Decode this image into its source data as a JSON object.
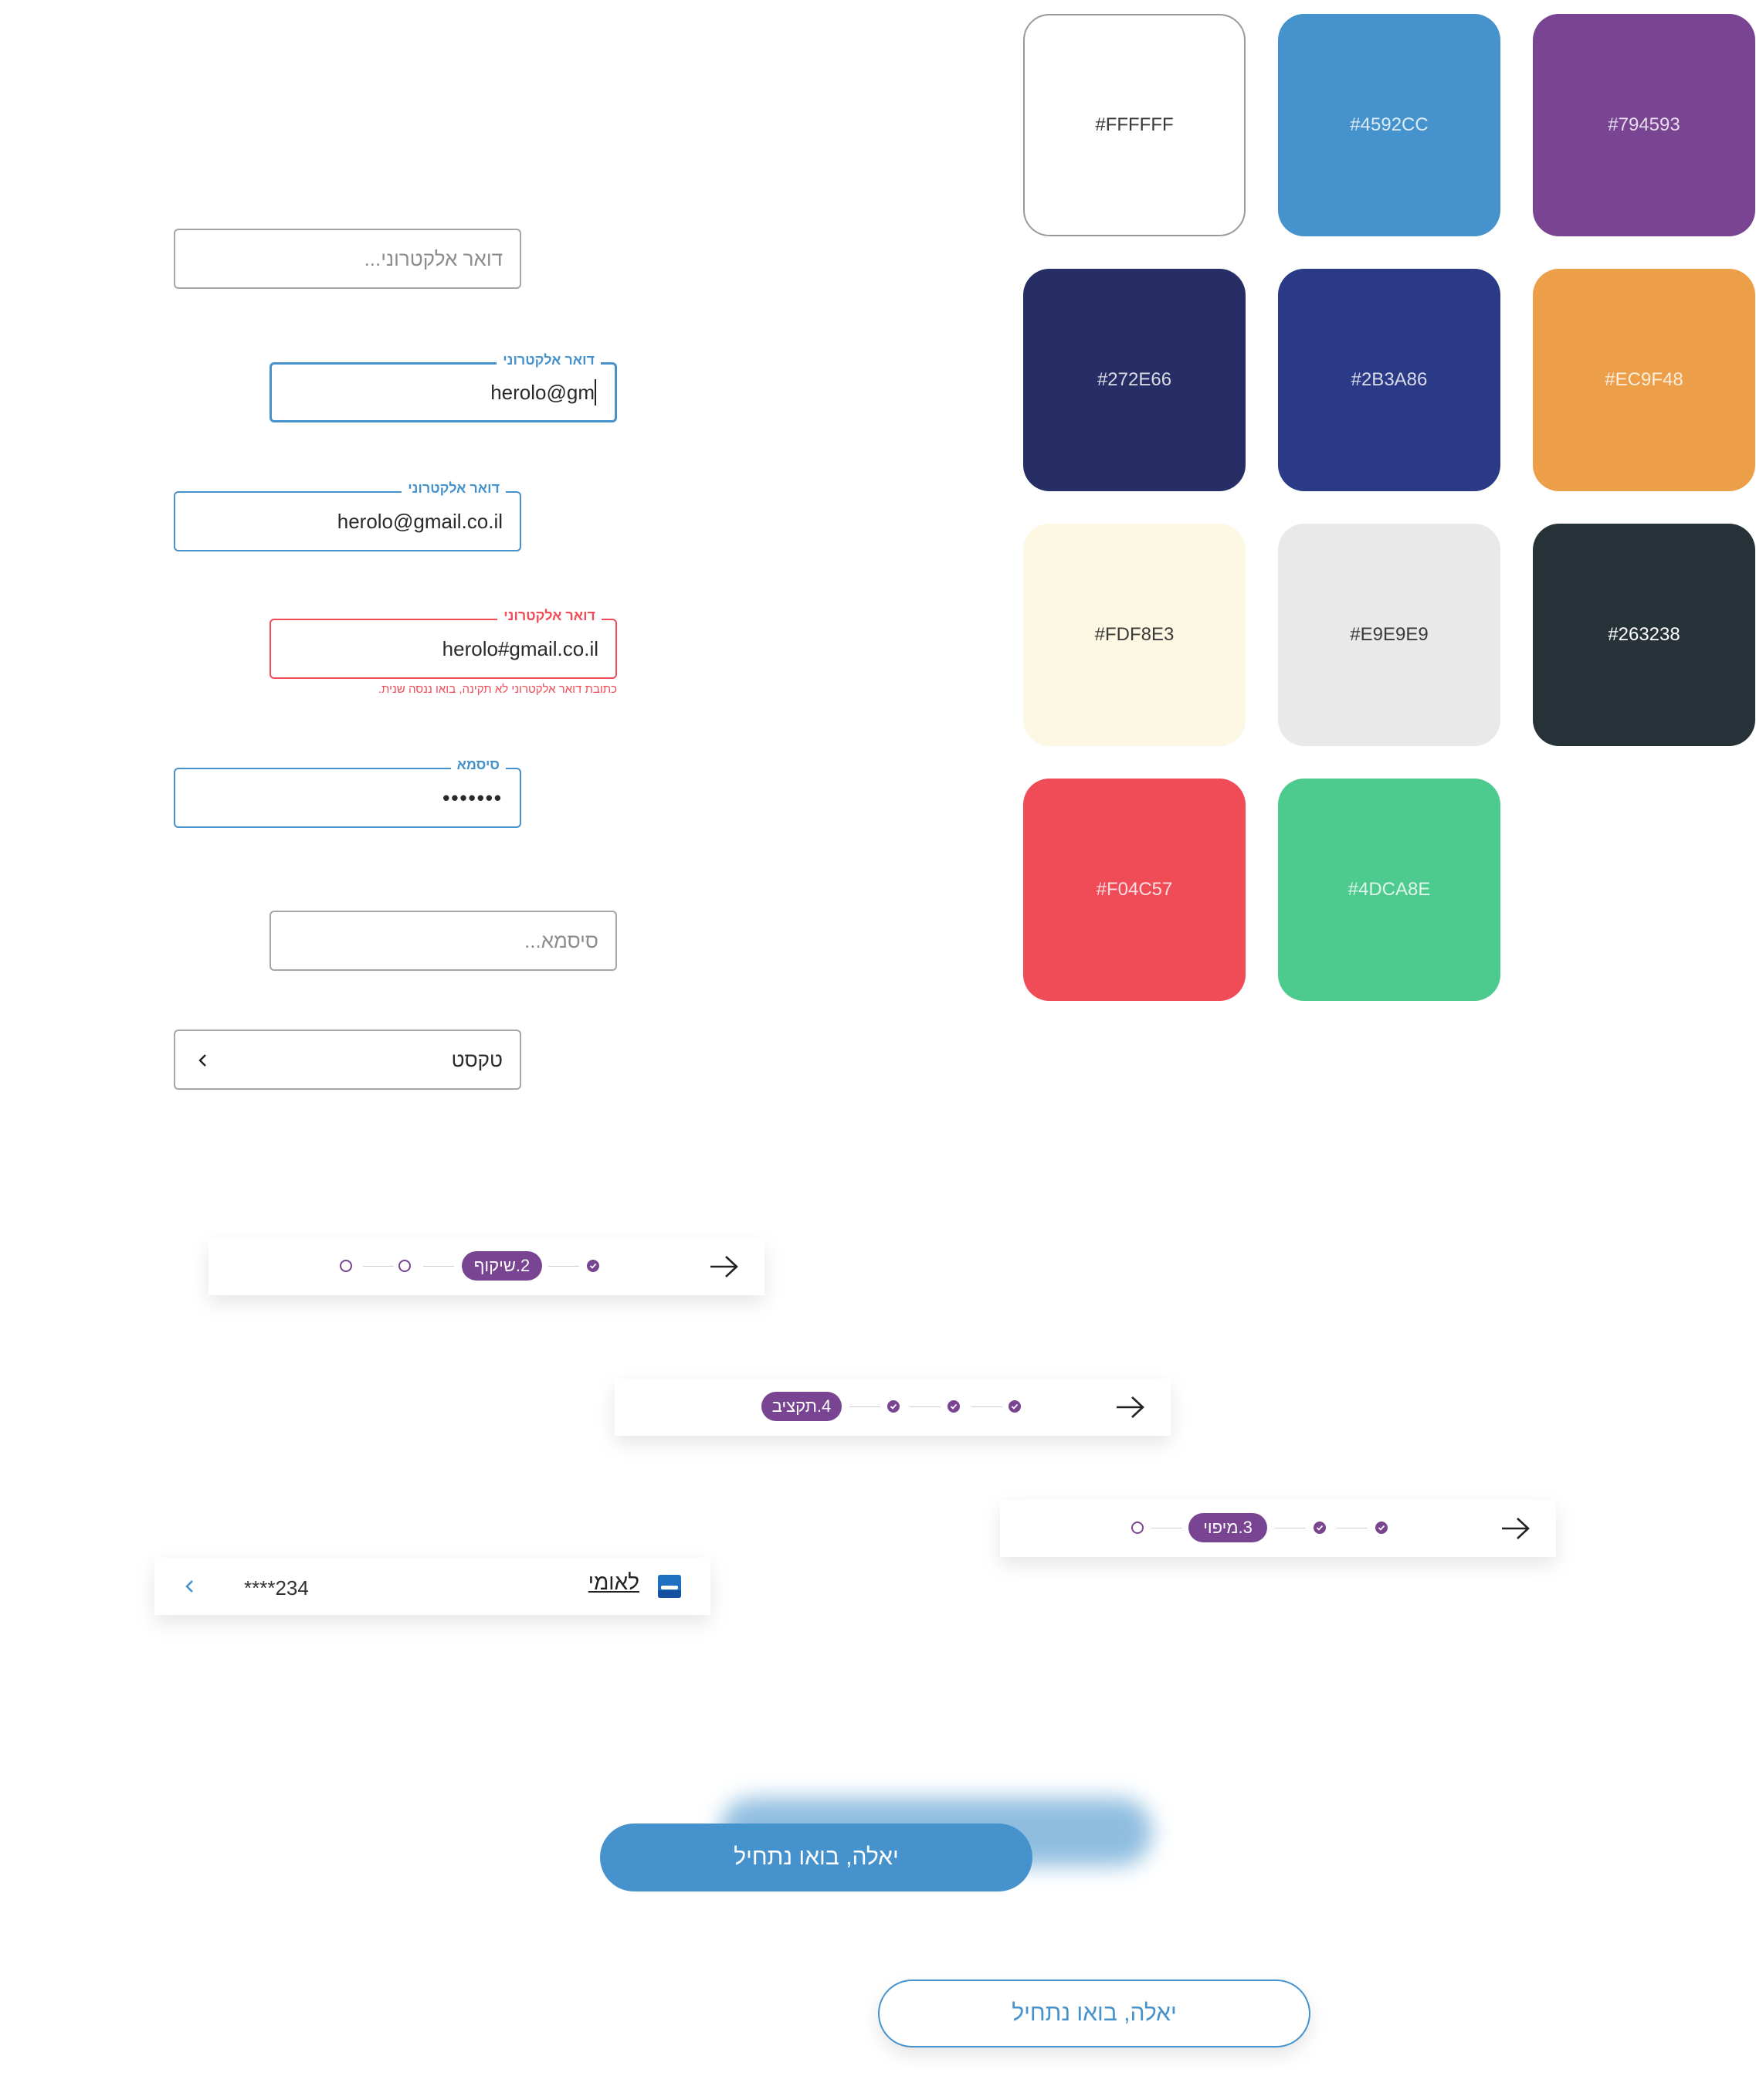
{
  "palette": [
    {
      "hex": "#FFFFFF",
      "color": "#FFFFFF"
    },
    {
      "hex": "#4592CC",
      "color": "#4592CC"
    },
    {
      "hex": "#794593",
      "color": "#794593"
    },
    {
      "hex": "#272E66",
      "color": "#272E66"
    },
    {
      "hex": "#2B3A86",
      "color": "#2B3A86"
    },
    {
      "hex": "#EC9F48",
      "color": "#EC9F48"
    },
    {
      "hex": "#FDF8E3",
      "color": "#FDF8E3"
    },
    {
      "hex": "#E9E9E9",
      "color": "#E9E9E9"
    },
    {
      "hex": "#263238",
      "color": "#263238"
    },
    {
      "hex": "#F04C57",
      "color": "#F04C57"
    },
    {
      "hex": "#4DCA8E",
      "color": "#4DCA8E"
    }
  ],
  "inputs": {
    "email_empty": {
      "placeholder": "דואר אלקטרוני..."
    },
    "email_focus": {
      "label": "דואר אלקטרוני",
      "value": "herolo@gm"
    },
    "email_filled": {
      "label": "דואר אלקטרוני",
      "value": "herolo@gmail.co.il"
    },
    "email_error": {
      "label": "דואר אלקטרוני",
      "value": "herolo#gmail.co.il",
      "error": "כתובת דואר אלקטרוני לא תקינה, בואו ננסה שנית."
    },
    "password_filled": {
      "label": "סיסמא",
      "value": "•••••••"
    },
    "password_empty": {
      "placeholder": "סיסמא..."
    },
    "select": {
      "value": "טקסט"
    }
  },
  "steppers": [
    {
      "active_label": "2.שיקוף",
      "completed": 1,
      "total": 4
    },
    {
      "active_label": "4.תקציב",
      "completed": 3,
      "total": 4
    },
    {
      "active_label": "3.מיפוי",
      "completed": 2,
      "total": 4
    }
  ],
  "bank_card": {
    "name": "לאומי",
    "account": "****234"
  },
  "buttons": {
    "primary": "יאלה, בואו נתחיל",
    "secondary": "יאלה, בואו נתחיל"
  },
  "icons": {
    "arrow": "arrow-right-icon",
    "chevron": "chevron-left-icon",
    "check": "check-icon",
    "bank_logo": "bank-logo-icon"
  }
}
